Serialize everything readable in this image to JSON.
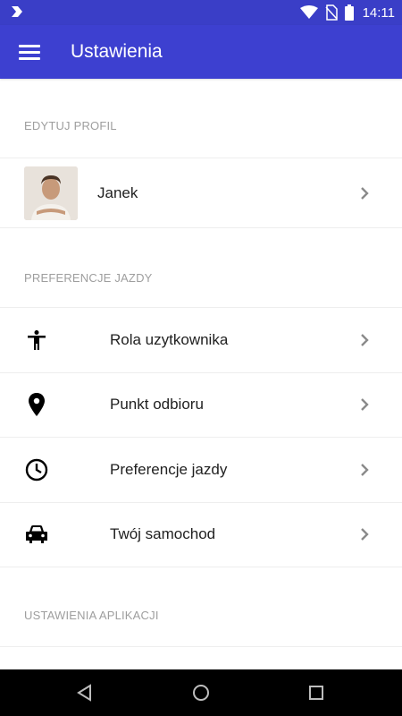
{
  "status_bar": {
    "time": "14:11"
  },
  "app_bar": {
    "title": "Ustawienia"
  },
  "sections": {
    "profile_header": "EDYTUJ PROFIL",
    "preferences_header": "PREFERENCJE JAZDY",
    "app_settings_header": "USTAWIENIA APLIKACJI"
  },
  "profile": {
    "name": "Janek"
  },
  "preferences": [
    {
      "label": "Rola uzytkownika",
      "icon": "person-icon"
    },
    {
      "label": "Punkt odbioru",
      "icon": "location-pin-icon"
    },
    {
      "label": "Preferencje jazdy",
      "icon": "clock-icon"
    },
    {
      "label": "Twój samochod",
      "icon": "car-icon"
    }
  ]
}
